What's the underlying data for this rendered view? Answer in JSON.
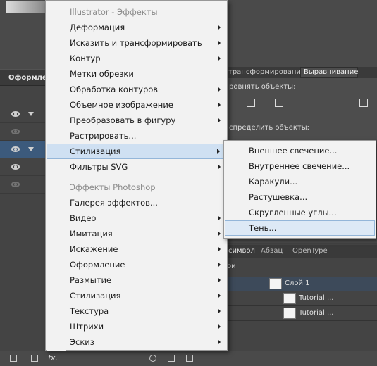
{
  "menu": {
    "items": [
      {
        "label": "Illustrator - Эффекты",
        "header": true,
        "submenu": false
      },
      {
        "label": "Деформация",
        "submenu": true
      },
      {
        "label": "Исказить и трансформировать",
        "submenu": true
      },
      {
        "label": "Контур",
        "submenu": true
      },
      {
        "label": "Метки обрезки",
        "submenu": false
      },
      {
        "label": "Обработка контуров",
        "submenu": true
      },
      {
        "label": "Объемное изображение",
        "submenu": true
      },
      {
        "label": "Преобразовать в фигуру",
        "submenu": true
      },
      {
        "label": "Растрировать...",
        "submenu": false
      },
      {
        "label": "Стилизация",
        "submenu": true,
        "selected": true
      },
      {
        "label": "Фильтры SVG",
        "submenu": true
      },
      {
        "label": "Эффекты Photoshop",
        "header": true,
        "submenu": false
      },
      {
        "label": "Галерея эффектов...",
        "submenu": false
      },
      {
        "label": "Видео",
        "submenu": true
      },
      {
        "label": "Имитация",
        "submenu": true
      },
      {
        "label": "Искажение",
        "submenu": true
      },
      {
        "label": "Оформление",
        "submenu": true
      },
      {
        "label": "Размытие",
        "submenu": true
      },
      {
        "label": "Стилизация",
        "submenu": true
      },
      {
        "label": "Текстура",
        "submenu": true
      },
      {
        "label": "Штрихи",
        "submenu": true
      },
      {
        "label": "Эскиз",
        "submenu": true
      }
    ]
  },
  "submenu": {
    "items": [
      {
        "label": "Внешнее свечение..."
      },
      {
        "label": "Внутреннее свечение..."
      },
      {
        "label": "Каракули..."
      },
      {
        "label": "Растушевка..."
      },
      {
        "label": "Скругленные углы..."
      },
      {
        "label": "Тень...",
        "selected": true
      }
    ]
  },
  "left_panel": {
    "tab_label": "Оформлен"
  },
  "right_panel": {
    "tabs": [
      "трансформирование",
      "Выравнивание"
    ],
    "align_objects": "ровнять объекты:",
    "distribute_objects": "спределить объекты:"
  },
  "layers_panel": {
    "tabs": [
      "символ",
      "Абзац",
      "OpenType"
    ],
    "section": "ои",
    "rows": [
      {
        "name": "Слой 1"
      },
      {
        "name": "Tutorial ..."
      },
      {
        "name": "Tutorial ..."
      }
    ]
  },
  "bottom_bar": {
    "fx_label": "fx."
  },
  "colors": {
    "menu_bg": "#f2f2f2",
    "highlight": "#cfe0f2",
    "panel": "#535353"
  }
}
